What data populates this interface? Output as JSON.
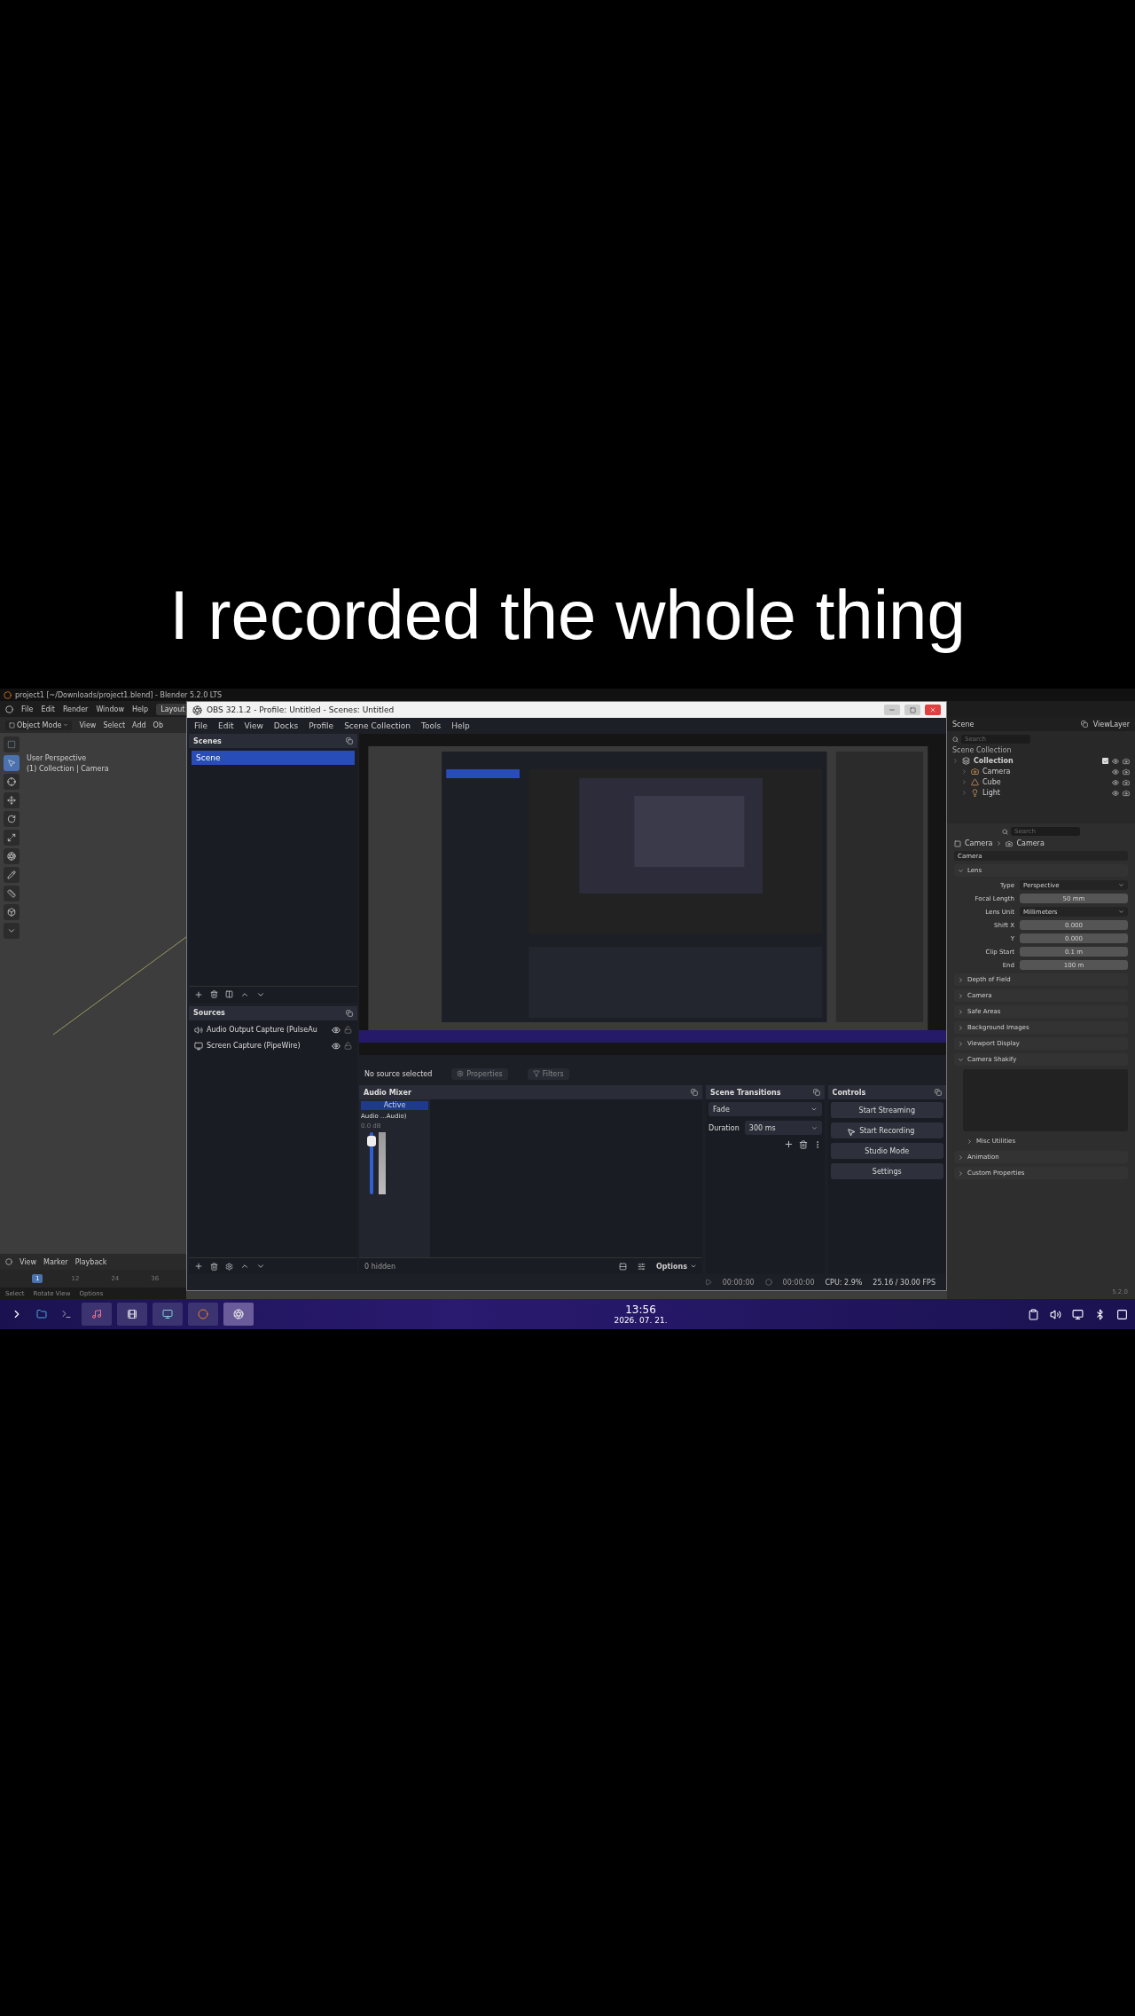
{
  "caption": "I recorded the whole thing",
  "blender": {
    "title": "project1 [~/Downloads/project1.blend] - Blender 5.2.0 LTS",
    "menu": [
      "File",
      "Edit",
      "Render",
      "Window",
      "Help"
    ],
    "workspace_tab": "Layout",
    "header": {
      "mode": "Object Mode",
      "menu": [
        "View",
        "Select",
        "Add",
        "Ob"
      ]
    },
    "tools": [
      {
        "kind": "select",
        "selected": true
      },
      {
        "kind": "cursor",
        "selected": false
      },
      {
        "kind": "move",
        "selected": false
      },
      {
        "kind": "rotate",
        "selected": false
      },
      {
        "kind": "scale",
        "selected": false
      },
      {
        "kind": "transform",
        "selected": false
      },
      {
        "kind": "annotate",
        "selected": false
      },
      {
        "kind": "measure",
        "selected": false
      },
      {
        "kind": "add",
        "selected": false
      },
      {
        "kind": "extra",
        "selected": false
      }
    ],
    "viewport": {
      "lines": [
        "User Perspective",
        "(1) Collection | Camera"
      ]
    },
    "timeline": {
      "menu": [
        "View",
        "Marker",
        "Playback"
      ],
      "frames": [
        {
          "label": "1",
          "selected": true
        },
        {
          "label": "12",
          "selected": false
        },
        {
          "label": "24",
          "selected": false
        },
        {
          "label": "36",
          "selected": false
        }
      ]
    },
    "status_bar": [
      "Select",
      "Rotate View",
      "Options"
    ],
    "scene": "Scene",
    "view_layer": "ViewLayer",
    "outliner_search_placeholder": "Search",
    "properties_search_placeholder": "Search",
    "outliner": {
      "root": "Scene Collection",
      "children": [
        {
          "label": "Collection",
          "kind": "collection",
          "checked": true,
          "children": [
            {
              "label": "Camera",
              "kind": "camera"
            },
            {
              "label": "Cube",
              "kind": "mesh"
            },
            {
              "label": "Light",
              "kind": "light"
            }
          ]
        }
      ]
    },
    "properties": {
      "breadcrumb": [
        "Camera",
        "Camera"
      ],
      "data_name": "Camera",
      "panels": [
        {
          "label": "Lens",
          "expanded": true,
          "fields": [
            {
              "label": "Type",
              "value": "Perspective",
              "kind": "dropdown"
            },
            {
              "label": "Focal Length",
              "value": "50 mm",
              "kind": "number"
            },
            {
              "label": "Lens Unit",
              "value": "Millimeters",
              "kind": "dropdown"
            },
            {
              "label": "Shift X",
              "value": "0.000",
              "kind": "number"
            },
            {
              "label": "Y",
              "value": "0.000",
              "kind": "number"
            },
            {
              "label": "Clip Start",
              "value": "0.1 m",
              "kind": "number"
            },
            {
              "label": "End",
              "value": "100 m",
              "kind": "number"
            }
          ]
        },
        {
          "label": "Depth of Field",
          "expanded": false
        },
        {
          "label": "Camera",
          "expanded": false
        },
        {
          "label": "Safe Areas",
          "expanded": false
        },
        {
          "label": "Background Images",
          "expanded": false
        },
        {
          "label": "Viewport Display",
          "expanded": false
        },
        {
          "label": "Camera Shakify",
          "expanded": true,
          "children": [
            {
              "label": "Misc Utilities",
              "expanded": false
            }
          ]
        },
        {
          "label": "Animation",
          "expanded": false
        },
        {
          "label": "Custom Properties",
          "expanded": false
        }
      ]
    },
    "version": "5.2.0"
  },
  "obs": {
    "title": "OBS 32.1.2 - Profile: Untitled - Scenes: Untitled",
    "menu": [
      "File",
      "Edit",
      "View",
      "Docks",
      "Profile",
      "Scene Collection",
      "Tools",
      "Help"
    ],
    "scenes": {
      "title": "Scenes",
      "items": [
        {
          "label": "Scene",
          "selected": true
        }
      ]
    },
    "sources": {
      "title": "Sources",
      "items": [
        {
          "label": "Audio Output Capture (PulseAu",
          "kind": "audio",
          "visible": true,
          "locked": false
        },
        {
          "label": "Screen Capture (PipeWire)",
          "kind": "screen",
          "visible": true,
          "locked": false
        }
      ]
    },
    "source_bar": {
      "text": "No source selected",
      "properties": "Properties",
      "filters": "Filters"
    },
    "audio_mixer": {
      "title": "Audio Mixer",
      "status": "Active",
      "channel": "Audio ...Audio)",
      "reading": "0.0 dB",
      "level": 0.93,
      "hidden": "0 hidden",
      "options": "Options"
    },
    "scene_transitions": {
      "title": "Scene Transitions",
      "transition": "Fade",
      "duration_label": "Duration",
      "duration": "300 ms"
    },
    "controls": {
      "title": "Controls",
      "buttons": [
        "Start Streaming",
        "Start Recording",
        "Studio Mode",
        "Settings"
      ]
    },
    "status": {
      "stream_time": "00:00:00",
      "record_time": "00:00:00",
      "cpu": "CPU: 2.9%",
      "fps": "25.16 / 30.00 FPS"
    }
  },
  "taskbar": {
    "launchers": [
      {
        "kind": "folder"
      },
      {
        "kind": "terminal"
      }
    ],
    "tasks": [
      {
        "kind": "media",
        "selected": false
      },
      {
        "kind": "app",
        "selected": false
      },
      {
        "kind": "monitor",
        "selected": false
      },
      {
        "kind": "blender",
        "selected": false
      },
      {
        "kind": "obs",
        "selected": true
      }
    ],
    "time": "13:56",
    "date": "2026. 07. 21."
  }
}
